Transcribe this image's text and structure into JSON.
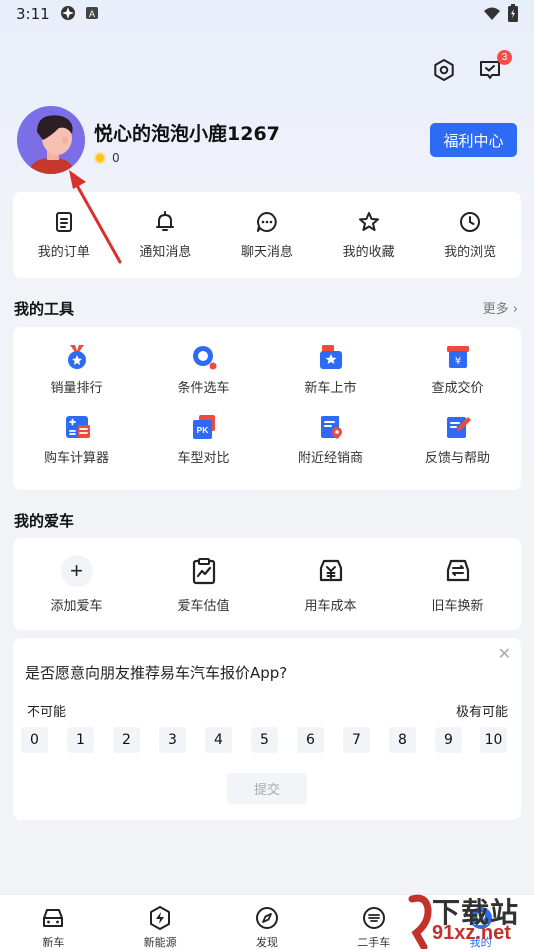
{
  "status_bar": {
    "time": "3:11"
  },
  "header": {
    "notification_count": "3"
  },
  "profile": {
    "username": "悦心的泡泡小鹿1267",
    "coins": "0",
    "welfare_button": "福利中心"
  },
  "quick_links": [
    {
      "label": "我的订单",
      "icon": "order-icon"
    },
    {
      "label": "通知消息",
      "icon": "bell-icon"
    },
    {
      "label": "聊天消息",
      "icon": "chat-icon"
    },
    {
      "label": "我的收藏",
      "icon": "star-icon"
    },
    {
      "label": "我的浏览",
      "icon": "clock-icon"
    }
  ],
  "tools": {
    "title": "我的工具",
    "more": "更多 ›",
    "items": [
      {
        "label": "销量排行",
        "icon": "medal-icon"
      },
      {
        "label": "条件选车",
        "icon": "search-icon"
      },
      {
        "label": "新车上市",
        "icon": "new-car-icon"
      },
      {
        "label": "查成交价",
        "icon": "price-icon"
      },
      {
        "label": "购车计算器",
        "icon": "calculator-icon"
      },
      {
        "label": "车型对比",
        "icon": "compare-icon"
      },
      {
        "label": "附近经销商",
        "icon": "dealer-icon"
      },
      {
        "label": "反馈与帮助",
        "icon": "feedback-icon"
      }
    ]
  },
  "my_cars": {
    "title": "我的爱车",
    "items": [
      {
        "label": "添加爱车",
        "icon": "plus-icon"
      },
      {
        "label": "爱车估值",
        "icon": "valuation-icon"
      },
      {
        "label": "用车成本",
        "icon": "cost-icon"
      },
      {
        "label": "旧车换新",
        "icon": "trade-in-icon"
      }
    ]
  },
  "survey": {
    "question": "是否愿意向朋友推荐易车汽车报价App?",
    "low_label": "不可能",
    "high_label": "极有可能",
    "scale": [
      "0",
      "1",
      "2",
      "3",
      "4",
      "5",
      "6",
      "7",
      "8",
      "9",
      "10"
    ],
    "submit": "提交"
  },
  "bottom_nav": [
    {
      "label": "新车",
      "icon": "car-icon"
    },
    {
      "label": "新能源",
      "icon": "energy-icon"
    },
    {
      "label": "发现",
      "icon": "compass-icon"
    },
    {
      "label": "二手车",
      "icon": "used-car-icon"
    },
    {
      "label": "我的",
      "icon": "profile-icon"
    }
  ],
  "watermark": {
    "text": "下载站",
    "sub": "91xz.net"
  },
  "colors": {
    "accent": "#2d6bf5",
    "badge": "#ff4a4a",
    "annotation": "#d9302b"
  }
}
